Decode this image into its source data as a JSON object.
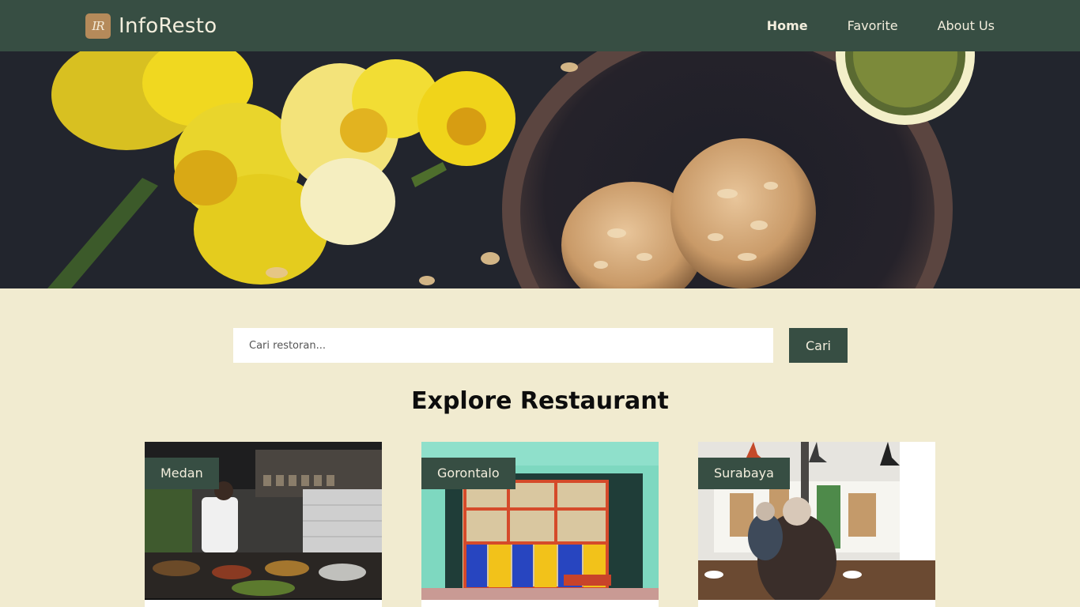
{
  "navbar": {
    "logo_text": "IR",
    "brand": "InfoResto",
    "links": [
      {
        "label": "Home",
        "active": true
      },
      {
        "label": "Favorite",
        "active": false
      },
      {
        "label": "About Us",
        "active": false
      }
    ]
  },
  "hero": {
    "image_icon": "hero-food-photo"
  },
  "search": {
    "placeholder": "Cari restoran...",
    "value": "",
    "button_label": "Cari"
  },
  "explore": {
    "title": "Explore Restaurant",
    "cards": [
      {
        "city": "Medan",
        "image_icon": "restaurant-kitchen-photo"
      },
      {
        "city": "Gorontalo",
        "image_icon": "storefront-photo"
      },
      {
        "city": "Surabaya",
        "image_icon": "cafe-interior-photo"
      }
    ]
  },
  "colors": {
    "navbar_bg": "#374e43",
    "page_bg": "#f1ebd0",
    "accent_logo": "#b58a5a",
    "nav_text": "#f3eedd"
  }
}
